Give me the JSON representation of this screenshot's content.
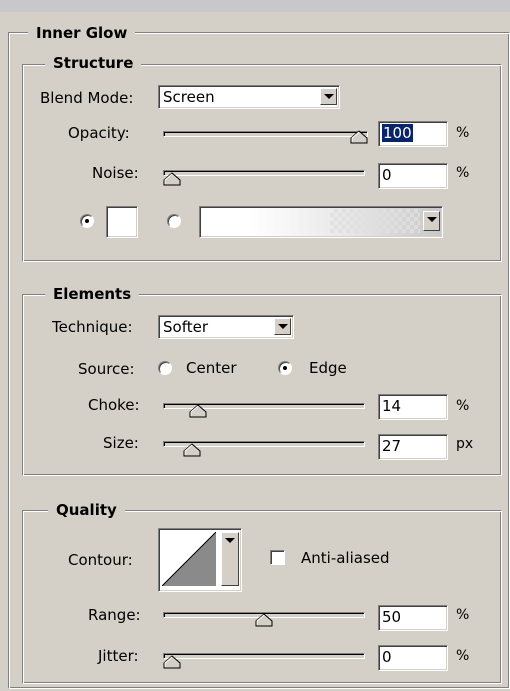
{
  "panel": {
    "title": "Inner Glow"
  },
  "structure": {
    "title": "Structure",
    "blend_mode": {
      "label": "Blend Mode:",
      "value": "Screen"
    },
    "opacity": {
      "label": "Opacity:",
      "value": "100",
      "unit": "%",
      "level": 1.0
    },
    "noise": {
      "label": "Noise:",
      "value": "0",
      "unit": "%",
      "level": 0.0
    },
    "glow_color": {
      "selected": "solid",
      "color": "#ffffff"
    },
    "gradient": {
      "selected": false
    }
  },
  "elements": {
    "title": "Elements",
    "technique": {
      "label": "Technique:",
      "value": "Softer"
    },
    "source": {
      "label": "Source:",
      "options": [
        "Center",
        "Edge"
      ],
      "selected": "Edge"
    },
    "choke": {
      "label": "Choke:",
      "value": "14",
      "unit": "%",
      "level": 0.14
    },
    "size": {
      "label": "Size:",
      "value": "27",
      "unit": "px",
      "level": 0.11
    }
  },
  "quality": {
    "title": "Quality",
    "contour": {
      "label": "Contour:"
    },
    "anti_aliased": {
      "label": "Anti-aliased",
      "checked": false
    },
    "range": {
      "label": "Range:",
      "value": "50",
      "unit": "%",
      "level": 0.5
    },
    "jitter": {
      "label": "Jitter:",
      "value": "0",
      "unit": "%",
      "level": 0.0
    }
  }
}
